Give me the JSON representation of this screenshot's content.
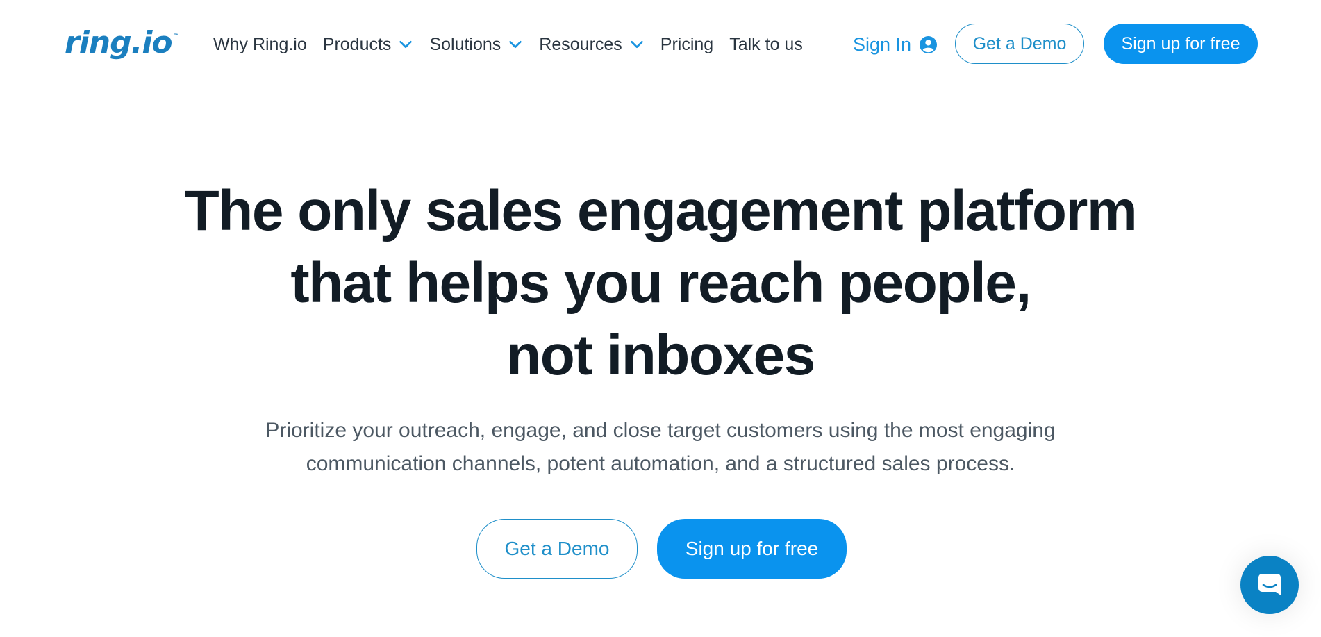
{
  "brand": {
    "logo_text": "ring.io",
    "trademark": "™",
    "primary_color": "#0a93ee",
    "text_color": "#121c25"
  },
  "nav": {
    "items": [
      {
        "label": "Why Ring.io",
        "has_dropdown": false
      },
      {
        "label": "Products",
        "has_dropdown": true
      },
      {
        "label": "Solutions",
        "has_dropdown": true
      },
      {
        "label": "Resources",
        "has_dropdown": true
      },
      {
        "label": "Pricing",
        "has_dropdown": false
      },
      {
        "label": "Talk to us",
        "has_dropdown": false
      }
    ],
    "sign_in": "Sign In",
    "demo_button": "Get a Demo",
    "signup_button": "Sign up for free"
  },
  "hero": {
    "title_lines": [
      "The only sales engagement platform",
      "that helps you reach people,",
      "not inboxes"
    ],
    "subtitle_lines": [
      "Prioritize your outreach, engage, and close target customers using the most engaging",
      "communication channels, potent automation, and a structured sales process."
    ],
    "demo_button": "Get a Demo",
    "signup_button": "Sign up for free"
  },
  "icons": {
    "nav_dropdown": "chevron-down-icon",
    "sign_in": "user-circle-icon",
    "chat": "chat-bubble-icon"
  }
}
